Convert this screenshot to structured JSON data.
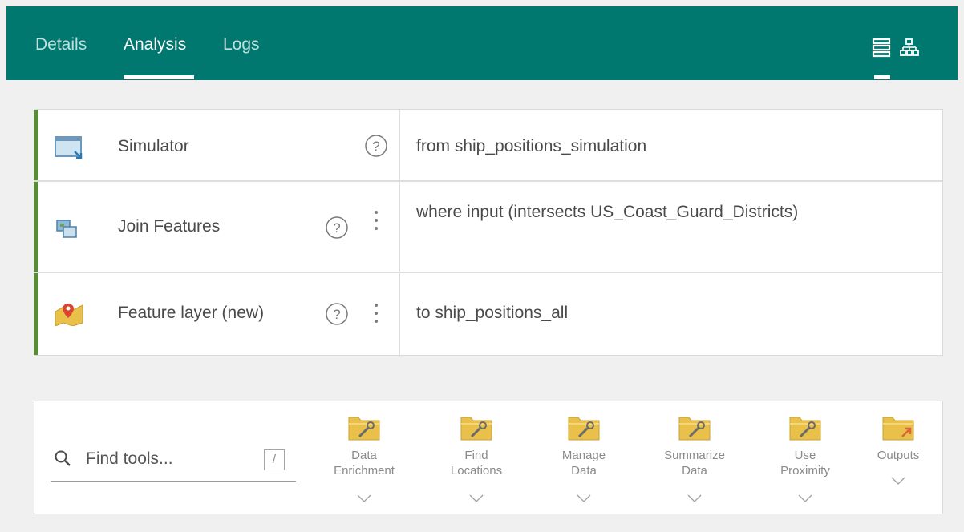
{
  "tabs": [
    {
      "label": "Details",
      "active": false
    },
    {
      "label": "Analysis",
      "active": true
    },
    {
      "label": "Logs",
      "active": false
    }
  ],
  "view_toggle": [
    {
      "name": "list-view-icon",
      "active": true
    },
    {
      "name": "diagram-view-icon",
      "active": false
    }
  ],
  "steps": [
    {
      "name": "Simulator",
      "description": "from ship_positions_simulation",
      "icon": "simulator-icon",
      "has_menu": false
    },
    {
      "name": "Join Features",
      "description": "where input (intersects US_Coast_Guard_Districts)",
      "icon": "join-features-icon",
      "has_menu": true
    },
    {
      "name": "Feature layer (new)",
      "description": "to ship_positions_all",
      "icon": "feature-layer-icon",
      "has_menu": true
    }
  ],
  "search": {
    "placeholder": "Find tools...",
    "shortcut": "/"
  },
  "tool_groups": [
    {
      "label": "Data\nEnrichment",
      "icon": "tool-folder-icon"
    },
    {
      "label": "Find\nLocations",
      "icon": "tool-folder-icon"
    },
    {
      "label": "Manage\nData",
      "icon": "tool-folder-icon"
    },
    {
      "label": "Summarize\nData",
      "icon": "tool-folder-icon"
    },
    {
      "label": "Use\nProximity",
      "icon": "tool-folder-icon"
    },
    {
      "label": "Outputs",
      "icon": "output-folder-icon"
    }
  ],
  "colors": {
    "header": "#00786f",
    "step_accent": "#5a8a3c",
    "folder": "#e8c04a",
    "output_arrow": "#d9653b"
  }
}
